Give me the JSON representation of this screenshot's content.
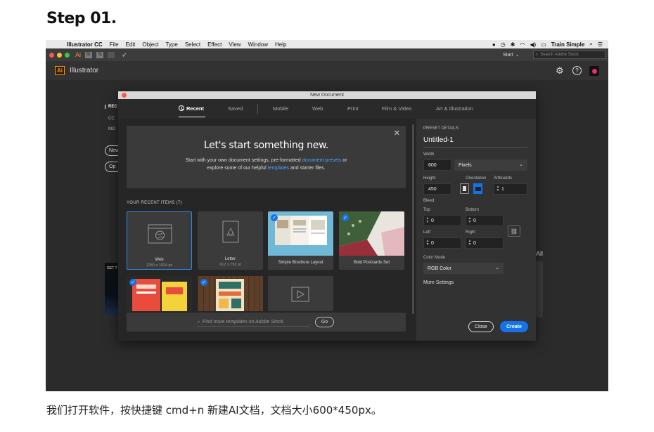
{
  "step_title": "Step 01.",
  "caption": "我们打开软件，按快捷键 cmd+n 新建AI文档，文档大小600*450px。",
  "menubar": {
    "app_name": "Illustrator CC",
    "items": [
      "File",
      "Edit",
      "Object",
      "Type",
      "Select",
      "Effect",
      "View",
      "Window",
      "Help"
    ],
    "user": "Train Simple"
  },
  "appbar": {
    "ai_label": "Ai",
    "badges": [
      "Br",
      "St"
    ],
    "start_label": "Start",
    "stock_placeholder": "Search Adobe Stock"
  },
  "homebar": {
    "logo": "Ai",
    "app_name": "Illustrator"
  },
  "home_bg": {
    "nav": [
      "REC",
      "CC",
      "MO"
    ],
    "pills": [
      "New",
      "Op"
    ],
    "tile_text": "GET T",
    "all_label": "All"
  },
  "dialog": {
    "title": "New Document",
    "tabs": [
      "Recent",
      "Saved",
      "Mobile",
      "Web",
      "Print",
      "Film & Video",
      "Art & Illustration"
    ],
    "hero": {
      "heading": "Let's start something new.",
      "line1_pre": "Start with your own document settings, pre-formatted ",
      "line1_link": "document presets",
      "line1_post": " or",
      "line2_pre": "explore some of our helpful ",
      "line2_link": "templates",
      "line2_post": " and starter files."
    },
    "recent_label": "YOUR RECENT ITEMS",
    "recent_count": "(7)",
    "tiles": [
      {
        "name": "Web",
        "sub": "1280 x 1024 px"
      },
      {
        "name": "Letter",
        "sub": "612 x 792 pt"
      },
      {
        "name": "Simple Brochure Layout",
        "sub": ""
      },
      {
        "name": "Bold Postcards Set",
        "sub": ""
      }
    ],
    "search_placeholder": "Find more templates on Adobe Stock",
    "go_label": "Go"
  },
  "preset": {
    "section_label": "PRESET DETAILS",
    "doc_name": "Untitled-1",
    "width_label": "Width",
    "width_value": "600",
    "unit": "Pixels",
    "height_label": "Height",
    "height_value": "450",
    "orientation_label": "Orientation",
    "artboards_label": "Artboards",
    "artboards_value": "1",
    "bleed_label": "Bleed",
    "top_label": "Top",
    "top_value": "0",
    "bottom_label": "Bottom",
    "bottom_value": "0",
    "left_label": "Left",
    "left_value": "0",
    "right_label": "Right",
    "right_value": "0",
    "color_mode_label": "Color Mode",
    "color_mode_value": "RGB Color",
    "more_settings": "More Settings",
    "close_label": "Close",
    "create_label": "Create"
  },
  "colors": {
    "accent": "#1473e6",
    "ai_orange": "#f7941d",
    "link": "#4fa3ff"
  }
}
